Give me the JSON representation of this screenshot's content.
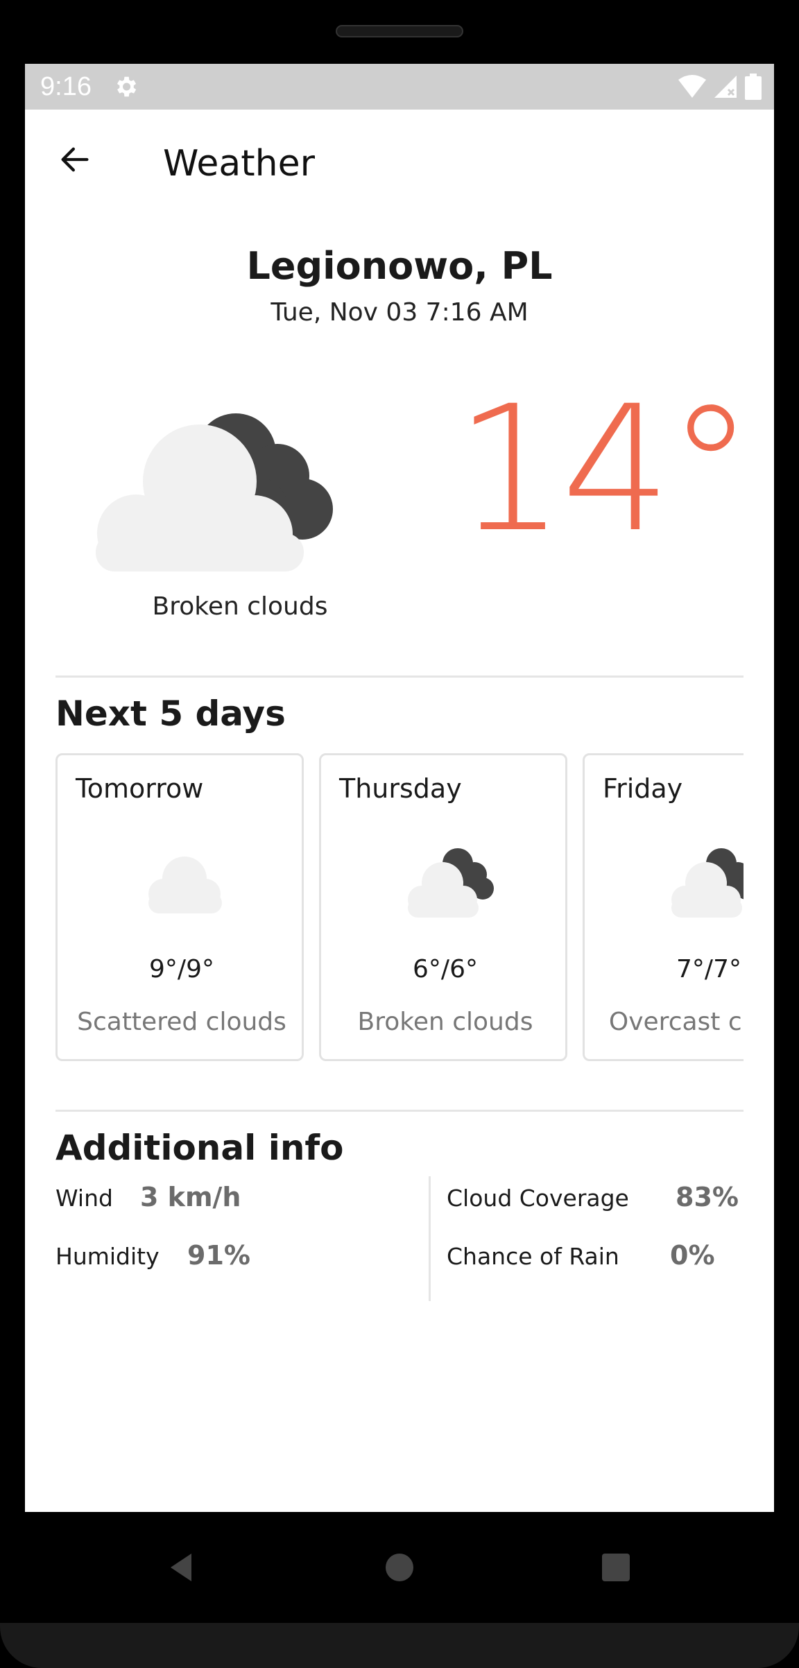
{
  "status_bar": {
    "time": "9:16",
    "icons": [
      "gear-icon",
      "wifi-icon",
      "signal-icon",
      "battery-icon"
    ]
  },
  "app_bar": {
    "title": "Weather",
    "back_icon": "arrow-left-icon"
  },
  "location": {
    "city": "Legionowo, PL",
    "datetime": "Tue, Nov 03 7:16 AM"
  },
  "current": {
    "temperature": "14°",
    "condition": "Broken clouds",
    "icon": "broken-clouds-icon"
  },
  "forecast": {
    "title": "Next 5 days",
    "days": [
      {
        "day": "Tomorrow",
        "temp": "9°/9°",
        "desc": "Scattered clouds",
        "icon": "scattered-clouds-icon"
      },
      {
        "day": "Thursday",
        "temp": "6°/6°",
        "desc": "Broken clouds",
        "icon": "broken-clouds-icon"
      },
      {
        "day": "Friday",
        "temp": "7°/7°",
        "desc": "Overcast clouds",
        "icon": "broken-clouds-icon"
      }
    ]
  },
  "additional": {
    "title": "Additional info",
    "wind_label": "Wind",
    "wind_value": "3 km/h",
    "humidity_label": "Humidity",
    "humidity_value": "91%",
    "cloud_label": "Cloud Coverage",
    "cloud_value": "83%",
    "rain_label": "Chance of Rain",
    "rain_value": "0%"
  },
  "nav_bar": {
    "icons": [
      "back-triangle-icon",
      "home-circle-icon",
      "recents-square-icon"
    ]
  },
  "colors": {
    "accent": "#ef6b4f",
    "status_bar": "#cfcfcf",
    "cloud_light": "#f1f1f1",
    "cloud_dark": "#444444"
  }
}
